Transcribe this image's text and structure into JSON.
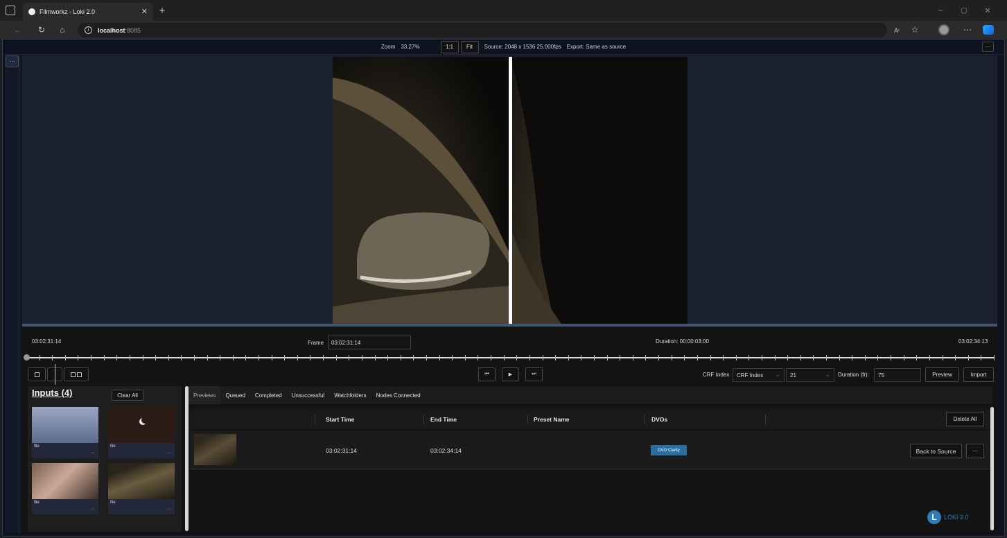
{
  "browser": {
    "tab_title": "Filmworkz - Loki 2.0",
    "url_host": "localhost",
    "url_port": ":8085"
  },
  "topbar": {
    "zoom_label": "Zoom",
    "zoom_value": "33.27%",
    "btn_1to1": "1:1",
    "btn_fit": "Fit",
    "source_info": "Source: 2048 x 1536 25.000fps",
    "export_info": "Export: Same as source",
    "more": "···"
  },
  "left_more": "···",
  "timeline": {
    "start_tc": "03:02:31:14",
    "frame_label": "Frame",
    "frame_value": "03:02:31:14",
    "duration": "Duration: 00:00:03:00",
    "end_tc": "03:02:34:13",
    "playhead_fraction": 0.0
  },
  "controls": {
    "crf_label": "CRF Index",
    "crf_select": "CRF Index",
    "crf_value": "21",
    "duration_label": "Duration (fr):",
    "duration_value": "75",
    "preview_btn": "Preview",
    "import_btn": "Import"
  },
  "inputs": {
    "title": "Inputs (4)",
    "clear_all": "Clear All",
    "items": [
      {
        "label": "file",
        "dots": "···"
      },
      {
        "label": "file",
        "dots": "···"
      },
      {
        "label": "file",
        "dots": "···"
      },
      {
        "label": "file",
        "dots": "···"
      }
    ]
  },
  "tabs": [
    "Previews",
    "Queued",
    "Completed",
    "Unsuccessful",
    "Watchfolders",
    "Nodes Connected"
  ],
  "table": {
    "headers": {
      "start": "Start Time",
      "end": "End Time",
      "preset": "Preset Name",
      "dvos": "DVOs"
    },
    "delete_all": "Delete All",
    "rows": [
      {
        "start": "03:02:31:14",
        "end": "03:02:34:14",
        "preset": "",
        "dvo": "DVO Clarity",
        "back": "Back to Source",
        "more": "···"
      }
    ]
  },
  "logo": {
    "letter": "L",
    "text": "LOKI 2.0"
  },
  "colors": {
    "accent": "#2e7bb5",
    "dvo_badge": "#2a6fa3",
    "frame_bg": "#1c2130"
  }
}
